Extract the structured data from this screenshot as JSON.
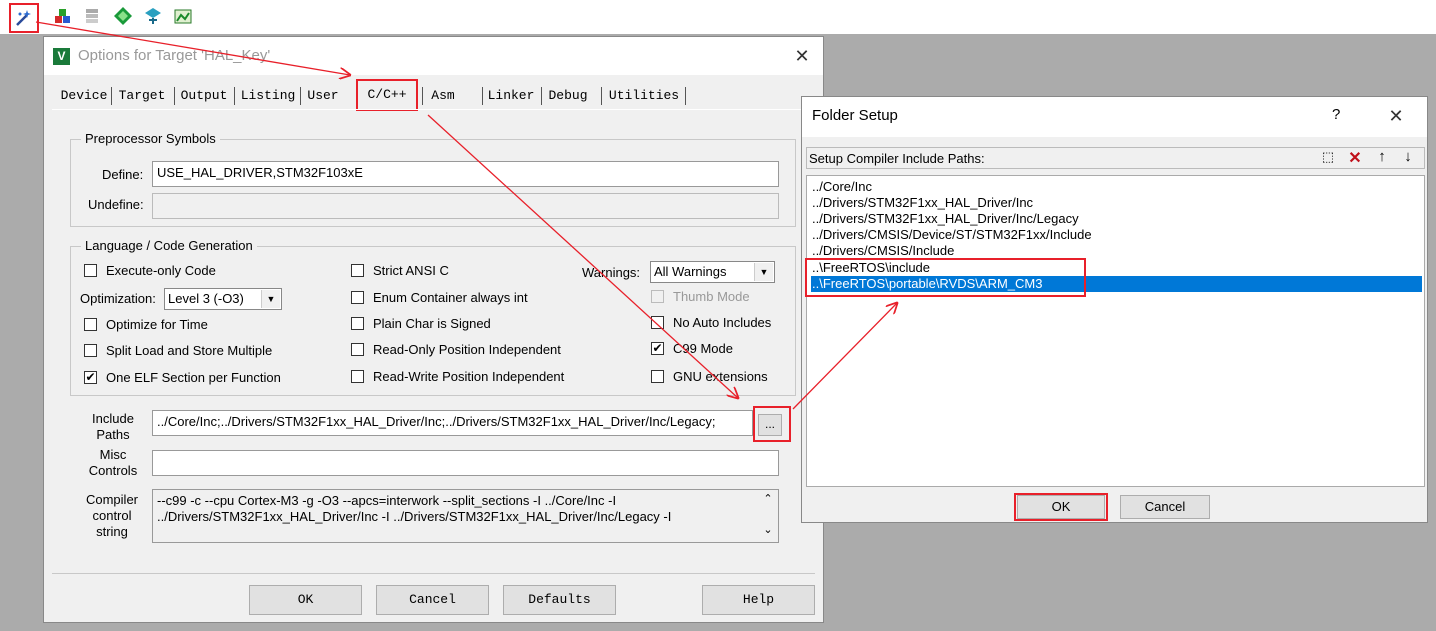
{
  "toolbar": {
    "icons": [
      "magic-wand-icon",
      "build-target-icon",
      "batch-build-icon",
      "diamond-icon",
      "tools-icon",
      "pack-icon"
    ]
  },
  "options_dialog": {
    "title": "Options for Target 'HAL_Key'",
    "tabs": [
      "Device",
      "Target",
      "Output",
      "Listing",
      "User",
      "C/C++",
      "Asm",
      "Linker",
      "Debug",
      "Utilities"
    ],
    "active_tab": "C/C++",
    "preprocessor": {
      "group_label": "Preprocessor Symbols",
      "define_label": "Define:",
      "define_value": "USE_HAL_DRIVER,STM32F103xE",
      "undefine_label": "Undefine:",
      "undefine_value": ""
    },
    "language": {
      "group_label": "Language / Code Generation",
      "execute_only": {
        "label": "Execute-only Code",
        "checked": false
      },
      "optimization_label": "Optimization:",
      "optimization_value": "Level 3 (-O3)",
      "optimize_time": {
        "label": "Optimize for Time",
        "checked": false
      },
      "split_load": {
        "label": "Split Load and Store Multiple",
        "checked": false
      },
      "one_elf": {
        "label": "One ELF Section per Function",
        "checked": true
      },
      "strict_ansi": {
        "label": "Strict ANSI C",
        "checked": false
      },
      "enum_container": {
        "label": "Enum Container always int",
        "checked": false
      },
      "plain_char": {
        "label": "Plain Char is Signed",
        "checked": false
      },
      "ro_pi": {
        "label": "Read-Only Position Independent",
        "checked": false
      },
      "rw_pi": {
        "label": "Read-Write Position Independent",
        "checked": false
      },
      "warnings_label": "Warnings:",
      "warnings_value": "All Warnings",
      "thumb_mode": {
        "label": "Thumb Mode",
        "checked": false
      },
      "no_auto_includes": {
        "label": "No Auto Includes",
        "checked": false
      },
      "c99_mode": {
        "label": "C99 Mode",
        "checked": true
      },
      "gnu_extensions": {
        "label": "GNU extensions",
        "checked": false
      }
    },
    "include_paths": {
      "label_line1": "Include",
      "label_line2": "Paths",
      "value": "../Core/Inc;../Drivers/STM32F1xx_HAL_Driver/Inc;../Drivers/STM32F1xx_HAL_Driver/Inc/Legacy;",
      "browse_label": "..."
    },
    "misc_controls": {
      "label_line1": "Misc",
      "label_line2": "Controls",
      "value": ""
    },
    "compiler_string": {
      "label_line1": "Compiler",
      "label_line2": "control",
      "label_line3": "string",
      "line1": "--c99 -c --cpu Cortex-M3 -g -O3 --apcs=interwork --split_sections -I ../Core/Inc -I",
      "line2": "../Drivers/STM32F1xx_HAL_Driver/Inc -I ../Drivers/STM32F1xx_HAL_Driver/Inc/Legacy -I"
    },
    "buttons": {
      "ok": "OK",
      "cancel": "Cancel",
      "defaults": "Defaults",
      "help": "Help"
    }
  },
  "folder_setup": {
    "title": "Folder Setup",
    "help_glyph": "?",
    "header_label": "Setup Compiler Include Paths:",
    "paths": [
      "../Core/Inc",
      "../Drivers/STM32F1xx_HAL_Driver/Inc",
      "../Drivers/STM32F1xx_HAL_Driver/Inc/Legacy",
      "../Drivers/CMSIS/Device/ST/STM32F1xx/Include",
      "../Drivers/CMSIS/Include",
      "..\\FreeRTOS\\include",
      "..\\FreeRTOS\\portable\\RVDS\\ARM_CM3"
    ],
    "selected_index": 6,
    "buttons": {
      "ok": "OK",
      "cancel": "Cancel"
    }
  },
  "colors": {
    "highlight": "#e8202a",
    "selection": "#0078d7"
  }
}
